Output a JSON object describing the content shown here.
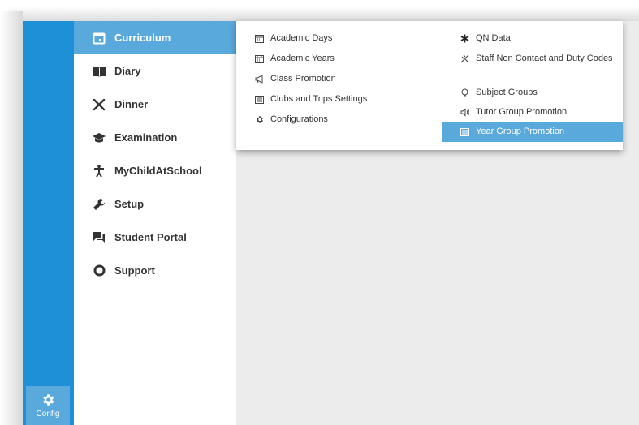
{
  "rail": {
    "config_label": "Config",
    "config_icon": "gear-icon"
  },
  "menu": {
    "items": [
      {
        "label": "Curriculum",
        "icon": "calendar-icon",
        "active": true
      },
      {
        "label": "Diary",
        "icon": "book-icon"
      },
      {
        "label": "Dinner",
        "icon": "cutlery-icon"
      },
      {
        "label": "Examination",
        "icon": "graduation-cap-icon"
      },
      {
        "label": "MyChildAtSchool",
        "icon": "person-icon"
      },
      {
        "label": "Setup",
        "icon": "wrench-icon"
      },
      {
        "label": "Student Portal",
        "icon": "chat-icon"
      },
      {
        "label": "Support",
        "icon": "circle-icon"
      }
    ]
  },
  "dropdown": {
    "left": [
      {
        "label": "Academic Days",
        "icon": "calendar-icon"
      },
      {
        "label": "Academic Years",
        "icon": "calendar-icon"
      },
      {
        "label": "Class Promotion",
        "icon": "megaphone-icon"
      },
      {
        "label": "Clubs and Trips Settings",
        "icon": "list-icon"
      },
      {
        "label": "Configurations",
        "icon": "gear-icon"
      }
    ],
    "right": [
      {
        "label": "QN Data",
        "icon": "asterisk-icon"
      },
      {
        "label": "Staff Non Contact and Duty Codes",
        "icon": "slash-icon"
      },
      {
        "label": "Subject Groups",
        "icon": "lightbulb-icon"
      },
      {
        "label": "Tutor Group Promotion",
        "icon": "speaker-icon"
      },
      {
        "label": "Year Group Promotion",
        "icon": "list-icon",
        "highlighted": true
      }
    ]
  },
  "colors": {
    "rail": "#1d90d8",
    "active": "#5aa9dc",
    "content_bg": "#ececec"
  }
}
